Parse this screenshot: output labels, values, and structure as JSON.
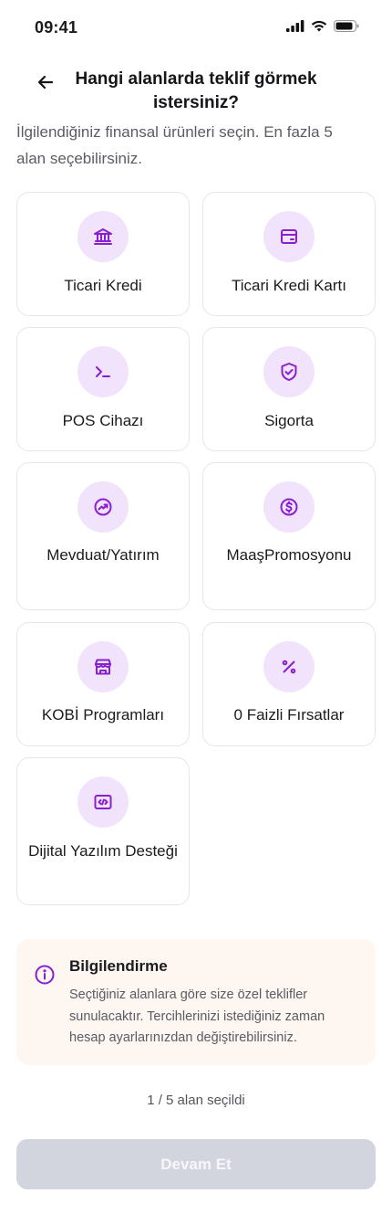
{
  "status": {
    "time": "09:41"
  },
  "header": {
    "title": "Hangi alanlarda teklif görmek istersiniz?"
  },
  "subtitle": "İlgilendiğiniz finansal ürünleri seçin. En fazla 5 alan seçebilirsiniz.",
  "categories": [
    {
      "label": "Ticari Kredi",
      "icon": "bank-icon"
    },
    {
      "label": "Ticari Kredi Kartı",
      "icon": "credit-card-icon"
    },
    {
      "label": "POS Cihazı",
      "icon": "terminal-icon"
    },
    {
      "label": "Sigorta",
      "icon": "shield-check-icon"
    },
    {
      "label": "Mevduat/Yatırım",
      "icon": "trend-up-icon"
    },
    {
      "label": "MaaşPromosyonu",
      "icon": "dollar-coin-icon"
    },
    {
      "label": "KOBİ Programları",
      "icon": "store-icon"
    },
    {
      "label": "0 Faizli Fırsatlar",
      "icon": "percent-icon"
    },
    {
      "label": "Dijital Yazılım Desteği",
      "icon": "code-icon"
    }
  ],
  "info": {
    "title": "Bilgilendirme",
    "text": "Seçtiğiniz alanlara göre size özel teklifler sunulacaktır. Tercihlerinizi istediğiniz zaman hesap ayarlarınızdan değiştirebilirsiniz.",
    "icon": "info-icon"
  },
  "counter": "1 / 5 alan seçildi",
  "cta": {
    "label": "Devam Et"
  },
  "colors": {
    "accent": "#8a1fd1",
    "icon_bg": "#f1e3fb",
    "info_bg": "#fdf6f1",
    "cta_disabled": "#d3d5de"
  }
}
